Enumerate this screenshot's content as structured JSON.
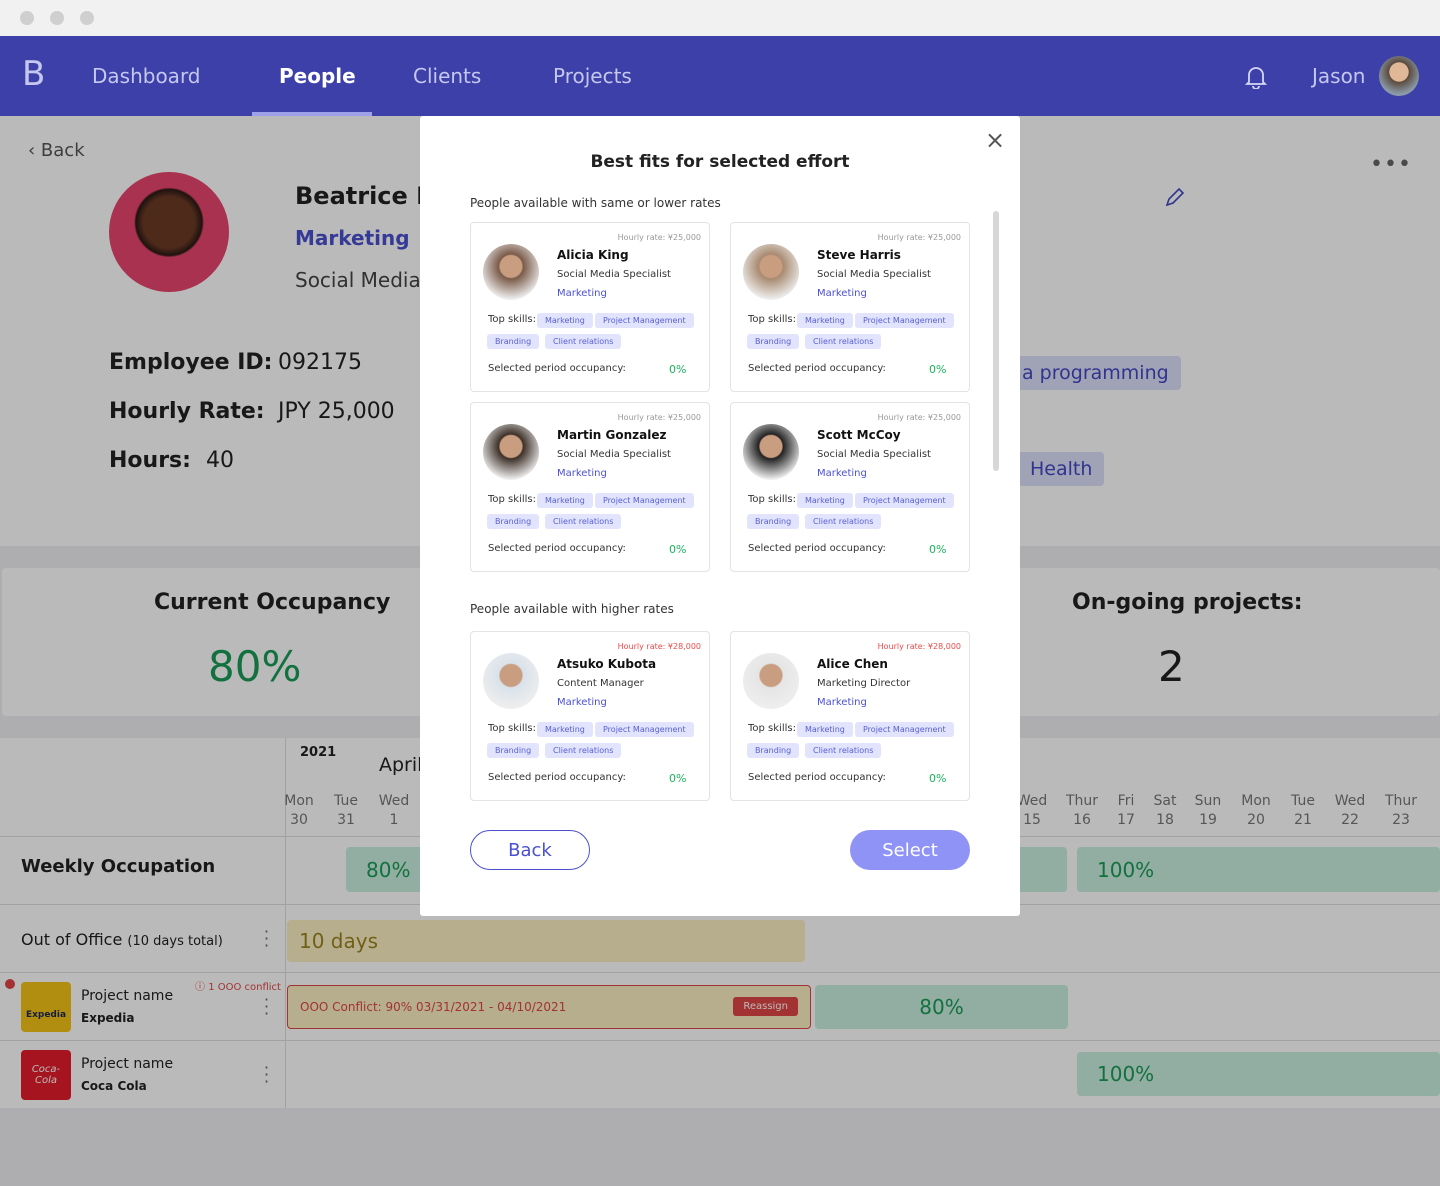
{
  "nav": {
    "logo": "B",
    "links": [
      "Dashboard",
      "People",
      "Clients",
      "Projects"
    ],
    "active": "People",
    "user": "Jason"
  },
  "profile": {
    "back": "Back",
    "name": "Beatrice Da",
    "department": "Marketing",
    "role": "Social Media S",
    "employee_id_label": "Employee ID:",
    "employee_id": "092175",
    "rate_label": "Hourly Rate:",
    "rate": "JPY 25,000",
    "hours_label": "Hours:",
    "hours": "40",
    "tags": [
      "a programming",
      "Health"
    ]
  },
  "stats": {
    "occupancy_title": "Current Occupancy",
    "occupancy": "80%",
    "projects_title": "On-going projects:",
    "projects": "2"
  },
  "timeline": {
    "year": "2021",
    "month": "April",
    "days": [
      {
        "d": "Mon",
        "n": "30"
      },
      {
        "d": "Tue",
        "n": "31"
      },
      {
        "d": "Wed",
        "n": "1"
      },
      {
        "d": "Wed",
        "n": "15"
      },
      {
        "d": "Thur",
        "n": "16"
      },
      {
        "d": "Fri",
        "n": "17"
      },
      {
        "d": "Sat",
        "n": "18"
      },
      {
        "d": "Sun",
        "n": "19"
      },
      {
        "d": "Mon",
        "n": "20"
      },
      {
        "d": "Tue",
        "n": "21"
      },
      {
        "d": "Wed",
        "n": "22"
      },
      {
        "d": "Thur",
        "n": "23"
      }
    ],
    "weekly_label": "Weekly Occupation",
    "weekly_values": [
      "80%",
      "100%"
    ],
    "ooo_label": "Out of Office",
    "ooo_total": "(10 days total)",
    "ooo_value": "10 days",
    "projects": [
      {
        "label": "Project name",
        "client": "Expedia",
        "logo": "Expedia",
        "conflict": "1 OOO conflict",
        "conflict_bar": "OOO Conflict: 90% 03/31/2021 - 04/10/2021",
        "reassign": "Reassign",
        "value": "80%"
      },
      {
        "label": "Project name",
        "client": "Coca Cola",
        "logo": "Coca-Cola",
        "value": "100%"
      }
    ]
  },
  "modal": {
    "title": "Best fits for selected effort",
    "section_same": "People available with same or lower rates",
    "section_higher": "People available with higher rates",
    "top_skills": "Top skills:",
    "occupancy_label": "Selected period occupancy:",
    "back": "Back",
    "select": "Select",
    "people": [
      {
        "name": "Alicia King",
        "role": "Social Media Specialist",
        "dept": "Marketing",
        "rate": "Hourly rate: ¥25,000",
        "occupancy": "0%",
        "skills": [
          "Marketing",
          "Project Management",
          "Branding",
          "Client relations"
        ],
        "higher": false
      },
      {
        "name": "Steve Harris",
        "role": "Social Media Specialist",
        "dept": "Marketing",
        "rate": "Hourly rate: ¥25,000",
        "occupancy": "0%",
        "skills": [
          "Marketing",
          "Project Management",
          "Branding",
          "Client relations"
        ],
        "higher": false
      },
      {
        "name": "Martin Gonzalez",
        "role": "Social Media Specialist",
        "dept": "Marketing",
        "rate": "Hourly rate: ¥25,000",
        "occupancy": "0%",
        "skills": [
          "Marketing",
          "Project Management",
          "Branding",
          "Client relations"
        ],
        "higher": false
      },
      {
        "name": "Scott McCoy",
        "role": "Social Media Specialist",
        "dept": "Marketing",
        "rate": "Hourly rate: ¥25,000",
        "occupancy": "0%",
        "skills": [
          "Marketing",
          "Project Management",
          "Branding",
          "Client relations"
        ],
        "higher": false
      },
      {
        "name": "Atsuko Kubota",
        "role": "Content Manager",
        "dept": "Marketing",
        "rate": "Hourly rate: ¥28,000",
        "occupancy": "0%",
        "skills": [
          "Marketing",
          "Project Management",
          "Branding",
          "Client relations"
        ],
        "higher": true
      },
      {
        "name": "Alice Chen",
        "role": "Marketing Director",
        "dept": "Marketing",
        "rate": "Hourly rate: ¥28,000",
        "occupancy": "0%",
        "skills": [
          "Marketing",
          "Project Management",
          "Branding",
          "Client relations"
        ],
        "higher": true
      }
    ]
  },
  "colors": {
    "nav": "#3d40a8",
    "accent": "#4b50d0",
    "green": "#1a9b55",
    "danger": "#e04545",
    "select": "#8f93f5"
  }
}
